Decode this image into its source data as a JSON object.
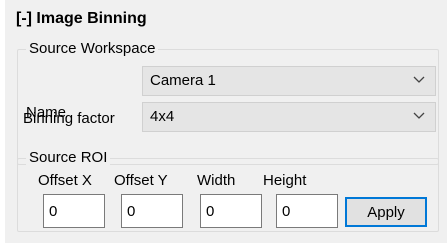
{
  "panel": {
    "title": "[-] Image Binning"
  },
  "source_workspace": {
    "legend": "Source Workspace",
    "name_label": "Name",
    "name_value": "Camera 1",
    "binning_label": "Binning factor",
    "binning_value": "4x4"
  },
  "source_roi": {
    "legend": "Source ROI",
    "offset_x_label": "Offset X",
    "offset_x_value": "0",
    "offset_y_label": "Offset Y",
    "offset_y_value": "0",
    "width_label": "Width",
    "width_value": "0",
    "height_label": "Height",
    "height_value": "0",
    "apply_label": "Apply"
  },
  "icons": {
    "dropdown": "chevron-down-icon"
  },
  "colors": {
    "panel_bg": "#f0f0f0",
    "combo_bg": "#e5e5e5",
    "button_focus_border": "#0078d7"
  }
}
